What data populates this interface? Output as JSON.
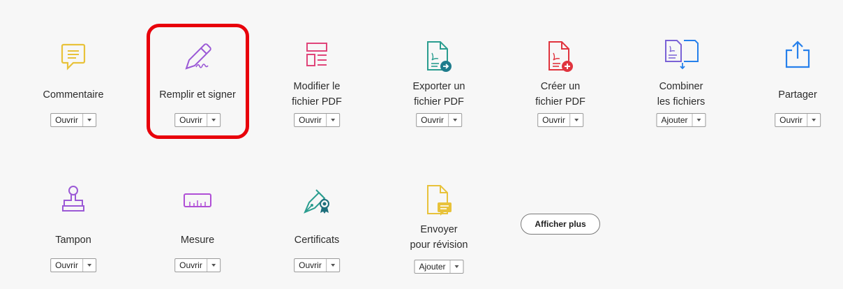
{
  "tools_row1": [
    {
      "label": "Commentaire",
      "button": "Ouvrir",
      "icon": "comment-icon"
    },
    {
      "label": "Remplir et signer",
      "button": "Ouvrir",
      "icon": "fill-sign-icon"
    },
    {
      "label": "Modifier le fichier PDF",
      "button": "Ouvrir",
      "icon": "edit-pdf-icon",
      "line1": "Modifier le",
      "line2": "fichier PDF"
    },
    {
      "label": "Exporter un fichier PDF",
      "button": "Ouvrir",
      "icon": "export-pdf-icon",
      "line1": "Exporter un",
      "line2": "fichier PDF"
    },
    {
      "label": "Créer un fichier PDF",
      "button": "Ouvrir",
      "icon": "create-pdf-icon",
      "line1": "Créer un",
      "line2": "fichier PDF"
    },
    {
      "label": "Combiner les fichiers",
      "button": "Ajouter",
      "icon": "combine-files-icon",
      "line1": "Combiner",
      "line2": "les fichiers"
    },
    {
      "label": "Partager",
      "button": "Ouvrir",
      "icon": "share-icon"
    }
  ],
  "tools_row2": [
    {
      "label": "Tampon",
      "button": "Ouvrir",
      "icon": "stamp-icon"
    },
    {
      "label": "Mesure",
      "button": "Ouvrir",
      "icon": "measure-icon"
    },
    {
      "label": "Certificats",
      "button": "Ouvrir",
      "icon": "certificates-icon"
    },
    {
      "label": "Envoyer pour révision",
      "button": "Ajouter",
      "icon": "send-review-icon",
      "line1": "Envoyer",
      "line2": "pour révision"
    }
  ],
  "show_more_label": "Afficher plus",
  "colors": {
    "highlight": "#e8000b",
    "comment": "#e8c23a",
    "fill_sign": "#9b59d6",
    "edit": "#e0457a",
    "export": "#2a9d8f",
    "create": "#e0343e",
    "combine": "#7a62d6",
    "share": "#2680eb",
    "stamp": "#9b59d6",
    "measure": "#b04fd6",
    "cert": "#2a9d8f",
    "review": "#e8c23a"
  }
}
